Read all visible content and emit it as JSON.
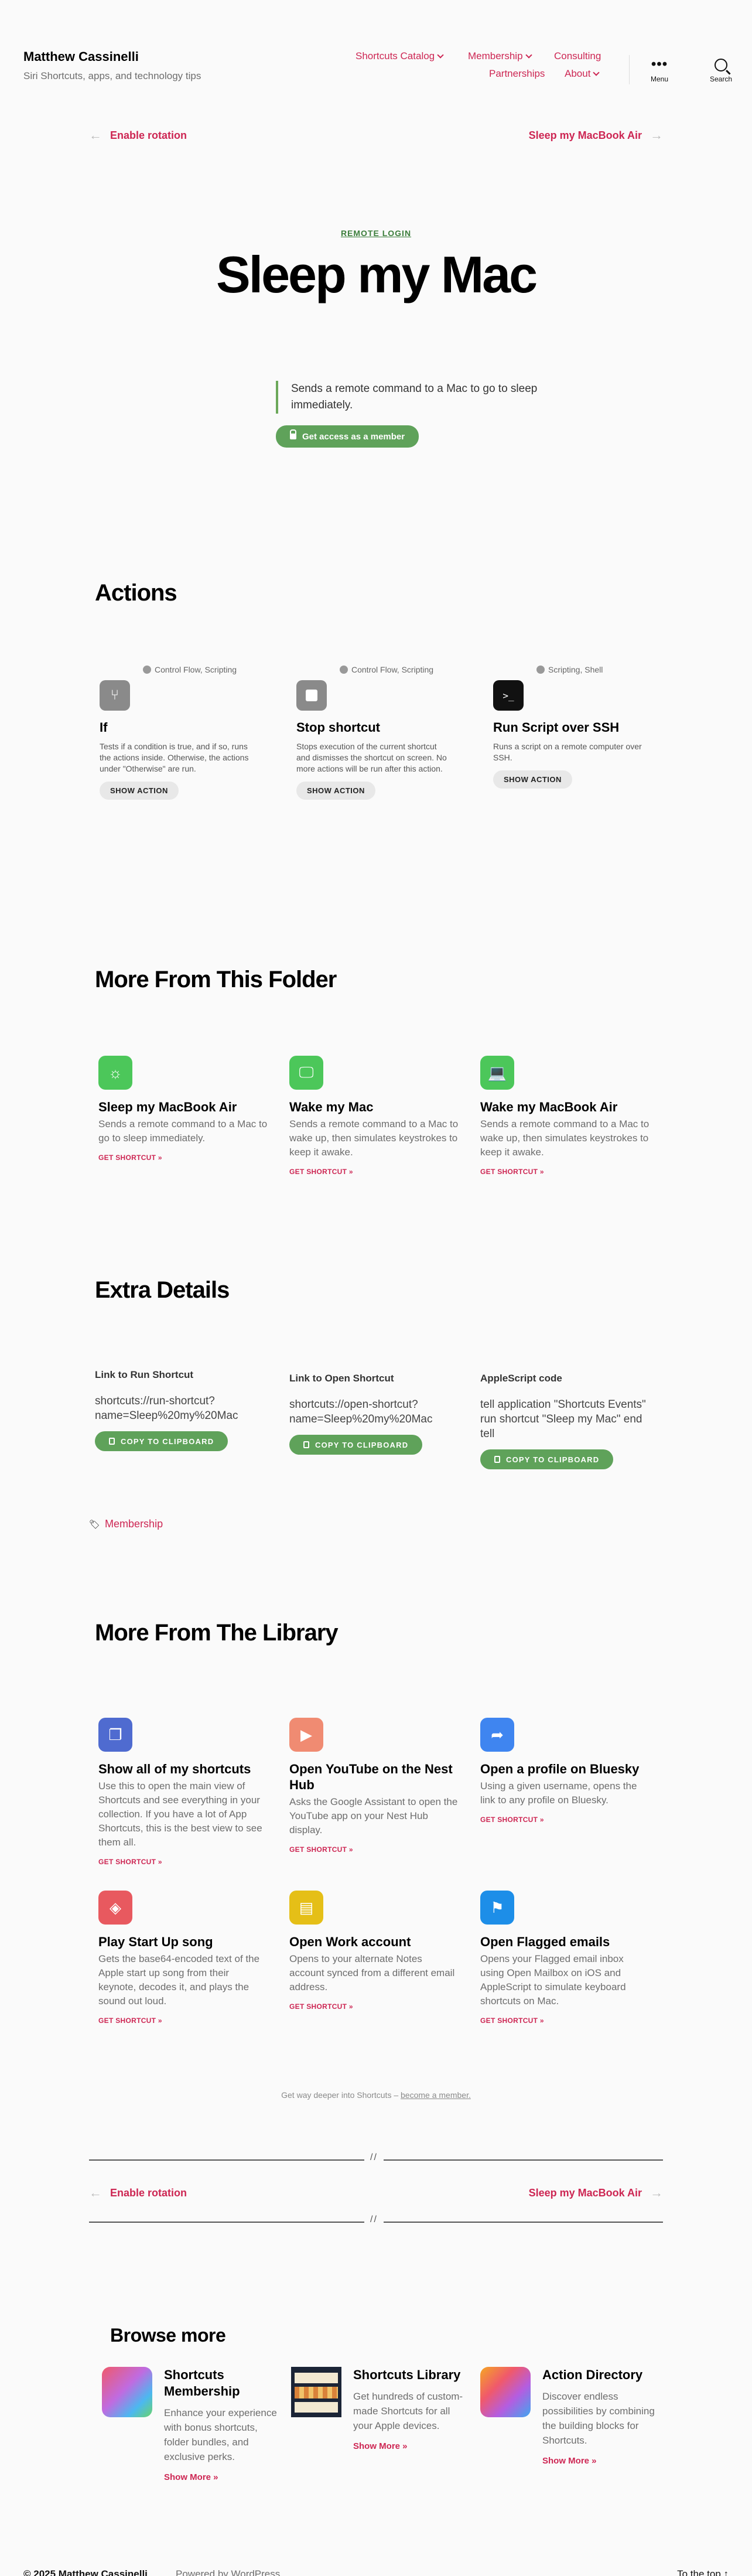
{
  "site": {
    "title": "Matthew Cassinelli",
    "description": "Siri Shortcuts, apps, and technology tips"
  },
  "nav": {
    "items": [
      "Shortcuts Catalog",
      "Membership",
      "Consulting",
      "Partnerships",
      "About"
    ],
    "menu_label": "Menu",
    "search_label": "Search"
  },
  "prev_next": {
    "prev": "Enable rotation",
    "next": "Sleep my MacBook Air"
  },
  "hero": {
    "eyebrow": "REMOTE LOGIN",
    "title": "Sleep my Mac",
    "description": "Sends a remote command to a Mac to go to sleep immediately.",
    "cta": "Get access as a member"
  },
  "actions": {
    "heading": "Actions",
    "items": [
      {
        "category": "Control Flow, Scripting",
        "name": "If",
        "desc": "Tests if a condition is true, and if so, runs the actions inside. Otherwise, the actions under \"Otherwise\" are run.",
        "button": "SHOW ACTION",
        "icon": "branch-icon",
        "color": "#8a8a8a"
      },
      {
        "category": "Control Flow, Scripting",
        "name": "Stop shortcut",
        "desc": "Stops execution of the current shortcut and dismisses the shortcut on screen. No more actions will be run after this action.",
        "button": "SHOW ACTION",
        "icon": "stop-icon",
        "color": "#8a8a8a"
      },
      {
        "category": "Scripting, Shell",
        "name": "Run Script over SSH",
        "desc": "Runs a script on a remote computer over SSH.",
        "button": "SHOW ACTION",
        "icon": "terminal-icon",
        "color": "#111111"
      }
    ]
  },
  "folder": {
    "heading": "More From This Folder",
    "items": [
      {
        "name": "Sleep my MacBook Air",
        "desc": "Sends a remote command to a Mac to go to sleep immediately.",
        "get": "GET SHORTCUT »",
        "icon": "sun-icon",
        "color": "#4cc75a"
      },
      {
        "name": "Wake my Mac",
        "desc": "Sends a remote command to a Mac to wake up, then simulates keystrokes to keep it awake.",
        "get": "GET SHORTCUT »",
        "icon": "monitor-icon",
        "color": "#4cc75a"
      },
      {
        "name": "Wake my MacBook Air",
        "desc": "Sends a remote command to a Mac to wake up, then simulates keystrokes to keep it awake.",
        "get": "GET SHORTCUT »",
        "icon": "laptop-icon",
        "color": "#4cc75a"
      }
    ]
  },
  "extra": {
    "heading": "Extra Details",
    "items": [
      {
        "label": "Link to Run Shortcut",
        "value": "shortcuts://run-shortcut?name=Sleep%20my%20Mac",
        "button": "COPY TO CLIPBOARD"
      },
      {
        "label": "Link to Open Shortcut",
        "value": "shortcuts://open-shortcut?name=Sleep%20my%20Mac",
        "button": "COPY TO CLIPBOARD"
      },
      {
        "label": "AppleScript code",
        "value": "tell application \"Shortcuts Events\" run shortcut \"Sleep my Mac\" end tell",
        "button": "COPY TO CLIPBOARD"
      }
    ]
  },
  "tag": "Membership",
  "library": {
    "heading": "More From The Library",
    "items": [
      {
        "name": "Show all of my shortcuts",
        "desc": "Use this to open the main view of Shortcuts and see everything in your collection. If you have a lot of App Shortcuts, this is the best view to see them all.",
        "get": "GET SHORTCUT »",
        "icon": "stack-icon",
        "color": "#4f6bd0"
      },
      {
        "name": "Open YouTube on the Nest Hub",
        "desc": "Asks the Google Assistant to open the YouTube app on your Nest Hub display.",
        "get": "GET SHORTCUT »",
        "icon": "play-icon",
        "color": "#f08b72"
      },
      {
        "name": "Open a profile on Bluesky",
        "desc": "Using a given username, opens the link to any profile on Bluesky.",
        "get": "GET SHORTCUT »",
        "icon": "share-icon",
        "color": "#3f85f0"
      },
      {
        "name": "Play Start Up song",
        "desc": "Gets the base64-encoded text of the Apple start up song from their keynote, decodes it, and plays the sound out loud.",
        "get": "GET SHORTCUT »",
        "icon": "stack-icon",
        "color": "#e8595f"
      },
      {
        "name": "Open Work account",
        "desc": "Opens to your alternate Notes account synced from a different email address.",
        "get": "GET SHORTCUT »",
        "icon": "notes-icon",
        "color": "#e5bf17"
      },
      {
        "name": "Open Flagged emails",
        "desc": "Opens your Flagged email inbox using Open Mailbox on iOS and AppleScript to simulate keyboard shortcuts on Mac.",
        "get": "GET SHORTCUT »",
        "icon": "flag-icon",
        "color": "#1d8ee8"
      }
    ]
  },
  "footer_note": {
    "text": "Get way deeper into Shortcuts –",
    "link": "become a member."
  },
  "browse": {
    "heading": "Browse more",
    "items": [
      {
        "name": "Shortcuts Membership",
        "desc": "Enhance your experience with bonus shortcuts, folder bundles, and exclusive perks.",
        "more": "Show More »"
      },
      {
        "name": "Shortcuts Library",
        "desc": "Get hundreds of custom-made Shortcuts for all your Apple devices.",
        "more": "Show More »"
      },
      {
        "name": "Action Directory",
        "desc": "Discover endless possibilities by combining the building blocks for Shortcuts.",
        "more": "Show More »"
      }
    ]
  },
  "bottom": {
    "copyright": "© 2025 Matthew Cassinelli",
    "powered": "Powered by WordPress",
    "top": "To the top ↑"
  }
}
